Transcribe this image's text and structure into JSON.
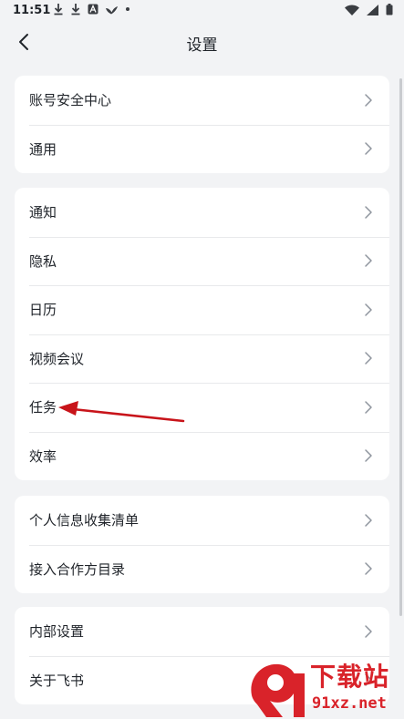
{
  "status_bar": {
    "time": "11:51"
  },
  "header": {
    "title": "设置"
  },
  "groups": [
    {
      "items": [
        {
          "label": "账号安全中心"
        },
        {
          "label": "通用"
        }
      ]
    },
    {
      "items": [
        {
          "label": "通知"
        },
        {
          "label": "隐私"
        },
        {
          "label": "日历"
        },
        {
          "label": "视频会议"
        },
        {
          "label": "任务"
        },
        {
          "label": "效率"
        }
      ]
    },
    {
      "items": [
        {
          "label": "个人信息收集清单"
        },
        {
          "label": "接入合作方目录"
        }
      ]
    },
    {
      "items": [
        {
          "label": "内部设置"
        },
        {
          "label": "关于飞书"
        }
      ]
    }
  ],
  "watermark": {
    "title": "下载站",
    "url": "91xz.net"
  },
  "colors": {
    "background": "#f2f3f5",
    "card": "#ffffff",
    "annotation_arrow": "#c8141a",
    "watermark": "#d9232a"
  }
}
